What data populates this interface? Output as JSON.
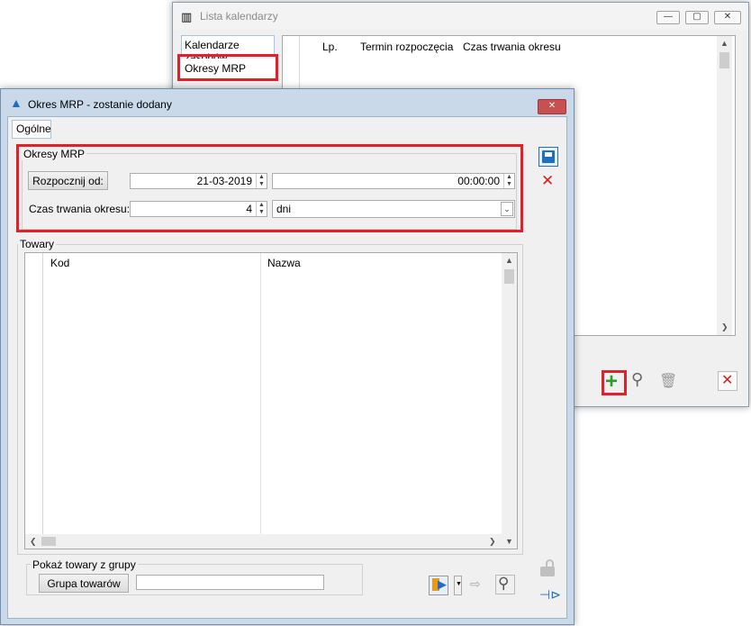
{
  "back_window": {
    "title": "Lista kalendarzy",
    "tabs": [
      "Kalendarze zasobów",
      "Okresy MRP"
    ],
    "columns": [
      "Lp.",
      "Termin rozpoczęcia",
      "Czas trwania okresu"
    ],
    "buttons": {
      "minimize": "—",
      "maximize": "▢",
      "close": "✕"
    }
  },
  "front_window": {
    "title": "Okres MRP - zostanie dodany",
    "tab": "Ogólne",
    "okresy_group": "Okresy MRP",
    "start_button": "Rozpocznij od:",
    "start_date": "21-03-2019",
    "start_time": "00:00:00",
    "duration_label": "Czas trwania okresu:",
    "duration_value": "4",
    "duration_unit": "dni",
    "towary_group": "Towary",
    "columns": [
      "Kod",
      "Nazwa"
    ],
    "show_group": "Pokaż towary z grupy",
    "group_button": "Grupa towarów",
    "group_value": ""
  },
  "colors": {
    "highlight": "#e0202a",
    "save": "#1e6fc4",
    "add": "#2a9d2a"
  }
}
